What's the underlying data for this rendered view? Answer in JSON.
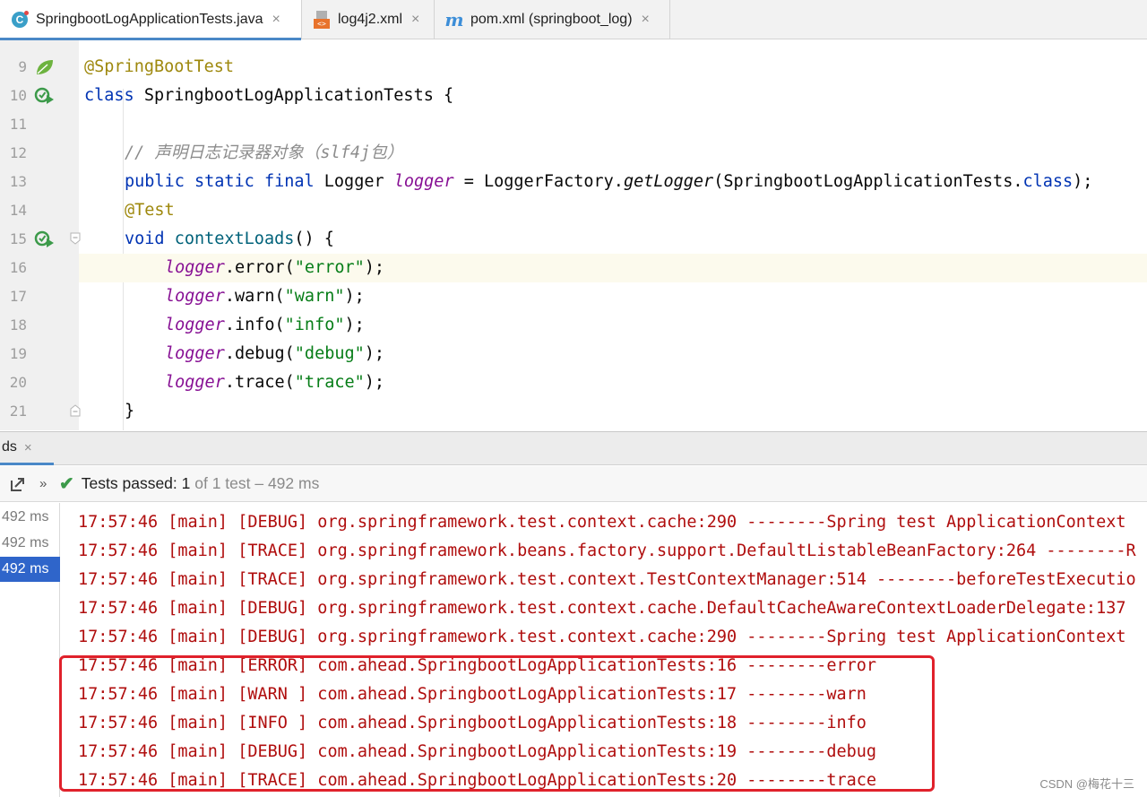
{
  "tabs": [
    {
      "label": "SpringbootLogApplicationTests.java",
      "icon": "java-class-icon",
      "active": true
    },
    {
      "label": "log4j2.xml",
      "icon": "xml-file-icon",
      "active": false
    },
    {
      "label": "pom.xml (springboot_log)",
      "icon": "maven-icon",
      "active": false
    }
  ],
  "tab_close_glyph": "×",
  "editor": {
    "top_partial_line": "8",
    "line_numbers": [
      "9",
      "10",
      "11",
      "12",
      "13",
      "14",
      "15",
      "16",
      "17",
      "18",
      "19",
      "20",
      "21"
    ],
    "current_line": "16",
    "code": {
      "l9": "@SpringBootTest",
      "l10_kw": "class",
      "l10_rest": " SpringbootLogApplicationTests {",
      "l12_comment": "// 声明日志记录器对象（slf4j包）",
      "l13_kw1": "public",
      "l13_kw2": "static",
      "l13_kw3": "final",
      "l13_type": " Logger ",
      "l13_field": "logger",
      "l13_mid": " = LoggerFactory.",
      "l13_method": "getLogger",
      "l13_arg": "(SpringbootLogApplicationTests.",
      "l13_classkw": "class",
      "l13_end": ");",
      "l14": "@Test",
      "l15_kw": "void",
      "l15_method": "contextLoads",
      "l15_end": "() {",
      "field": "logger",
      "l16_call": ".error(",
      "l16_str": "\"error\"",
      "l17_call": ".warn(",
      "l17_str": "\"warn\"",
      "l18_call": ".info(",
      "l18_str": "\"info\"",
      "l19_call": ".debug(",
      "l19_str": "\"debug\"",
      "l20_call": ".trace(",
      "l20_str": "\"trace\"",
      "call_end": ");",
      "l21": "}"
    }
  },
  "run_window": {
    "tab_label": "ds",
    "tab_close": "×",
    "toolbar": {
      "chevron": "»",
      "status_prefix": "Tests passed: ",
      "status_count": "1",
      "status_suffix": " of 1 test – 492 ms"
    },
    "durations": [
      "492 ms",
      "492 ms",
      "492 ms"
    ],
    "selected_duration_index": 2,
    "log_lines": [
      "17:57:46 [main] [DEBUG] org.springframework.test.context.cache:290 --------Spring test ApplicationContext",
      "17:57:46 [main] [TRACE] org.springframework.beans.factory.support.DefaultListableBeanFactory:264 --------R",
      "17:57:46 [main] [TRACE] org.springframework.test.context.TestContextManager:514 --------beforeTestExecutio",
      "17:57:46 [main] [DEBUG] org.springframework.test.context.cache.DefaultCacheAwareContextLoaderDelegate:137",
      "17:57:46 [main] [DEBUG] org.springframework.test.context.cache:290 --------Spring test ApplicationContext",
      "17:57:46 [main] [ERROR] com.ahead.SpringbootLogApplicationTests:16 --------error",
      "17:57:46 [main] [WARN ] com.ahead.SpringbootLogApplicationTests:17 --------warn",
      "17:57:46 [main] [INFO ] com.ahead.SpringbootLogApplicationTests:18 --------info",
      "17:57:46 [main] [DEBUG] com.ahead.SpringbootLogApplicationTests:19 --------debug",
      "17:57:46 [main] [TRACE] com.ahead.SpringbootLogApplicationTests:20 --------trace"
    ]
  },
  "watermark": "CSDN @梅花十三",
  "colors": {
    "accent": "#4a88c7",
    "log_text": "#b00e0e",
    "highlight_box": "#e0212b",
    "selection": "#2f65ca",
    "pass_green": "#3c9a4a"
  }
}
